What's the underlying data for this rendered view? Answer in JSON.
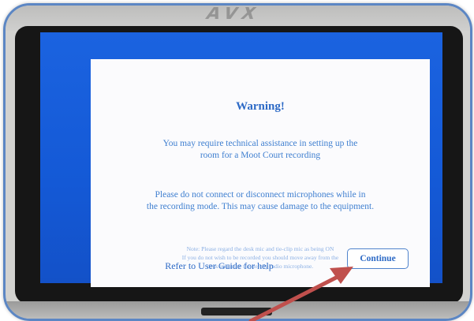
{
  "dialog": {
    "title": "Warning!",
    "message_1": "You may require technical assistance in setting up the\nroom for a Moot Court recording",
    "message_2": "Please do not connect or disconnect microphones while in\nthe recording mode. This may cause damage to the equipment.",
    "note": "Note: Please regard the desk mic and tie-clip mic as being ON\nIf you do not wish to be recorded you should move away from the\ndesk and mute the tie-clip radio microphone.",
    "help_text": "Refer to User Guide for help",
    "continue_label": "Continue"
  },
  "colors": {
    "screen_blue": "#1459d6",
    "dialog_text": "#2d6ac6",
    "frame_border": "#5b86c4",
    "arrow": "#c0504d"
  },
  "icons": {
    "annotation": "arrow-pointing-to-continue"
  }
}
